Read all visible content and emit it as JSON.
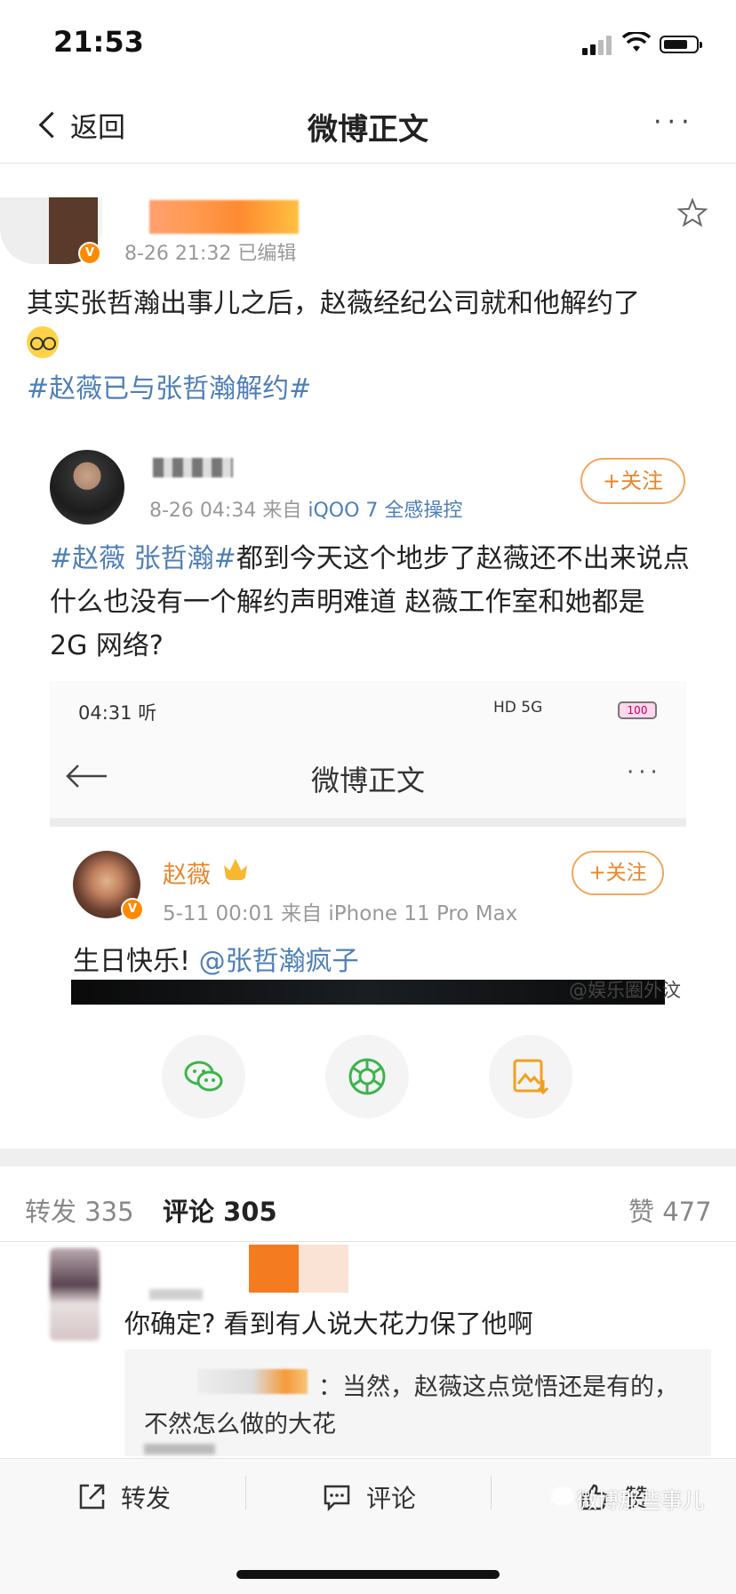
{
  "status_bar": {
    "time": "21:53"
  },
  "nav": {
    "back_label": "返回",
    "title": "微博正文",
    "more": "···"
  },
  "post": {
    "meta": "8-26 21:32   已编辑",
    "text": "其实张哲瀚出事儿之后，赵薇经纪公司就和他解约了",
    "hashtag": "#赵薇已与张哲瀚解约#"
  },
  "retweet": {
    "meta_time": "8-26 04:34  来自",
    "meta_source": "iQOO 7 全感操控",
    "follow_label": "+关注",
    "text_tag": "#赵薇 张哲瀚#",
    "text": "都到今天这个地步了赵薇还不出来说点什么也没有一个解约声明难道 赵薇工作室和她都是 2G 网络?",
    "screenshot": {
      "status_time": "04:31 听",
      "status_right": "HD 5G",
      "battery": "100",
      "title": "微博正文",
      "more": "···",
      "author": "赵薇",
      "meta": "5-11 00:01  来自 iPhone 11 Pro Max",
      "follow_label": "+关注",
      "text": "生日快乐!",
      "mention": "@张哲瀚疯子",
      "watermark": "@娱乐圈外汶"
    }
  },
  "stats": {
    "repost": "转发 335",
    "comment": "评论 305",
    "like": "赞 477"
  },
  "comment": {
    "text": "你确定? 看到有人说大花力保了他啊",
    "reply_text": "：当然，赵薇这点觉悟还是有的，",
    "reply_text2": "不然怎么做的大花"
  },
  "bottom_bar": {
    "repost": "转发",
    "comment": "评论",
    "like": "赞",
    "watermark": "微博那些事儿"
  },
  "colors": {
    "link": "#4e7fb7",
    "accent": "#e8862b"
  }
}
